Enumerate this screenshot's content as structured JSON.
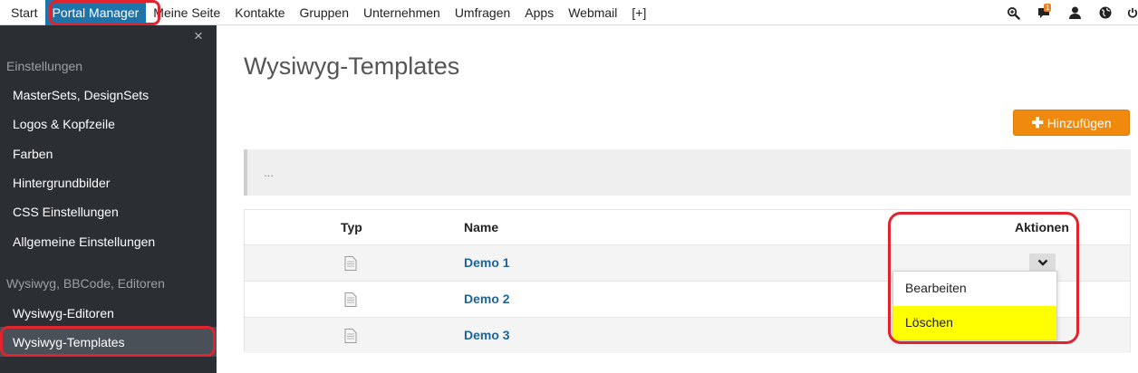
{
  "nav": {
    "items": [
      {
        "label": "Start"
      },
      {
        "label": "Portal Manager"
      },
      {
        "label": "Meine Seite"
      },
      {
        "label": "Kontakte"
      },
      {
        "label": "Gruppen"
      },
      {
        "label": "Unternehmen"
      },
      {
        "label": "Umfragen"
      },
      {
        "label": "Apps"
      },
      {
        "label": "Webmail"
      },
      {
        "label": "[+]"
      }
    ],
    "active_index": 1,
    "icons": [
      "search-icon",
      "chat-icon",
      "user-icon",
      "globe-icon",
      "power-icon"
    ],
    "chat_badge": "1"
  },
  "sidebar": {
    "close": "×",
    "section1": "Einstellungen",
    "items1": [
      "MasterSets, DesignSets",
      "Logos & Kopfzeile",
      "Farben",
      "Hintergrundbilder",
      "CSS Einstellungen",
      "Allgemeine Einstellungen"
    ],
    "section2": "Wysiwyg, BBCode, Editoren",
    "items2": [
      "Wysiwyg-Editoren",
      "Wysiwyg-Templates"
    ],
    "active_item": "Wysiwyg-Templates"
  },
  "main": {
    "title": "Wysiwyg-Templates",
    "add_button": "Hinzufügen",
    "info_text": "...",
    "table": {
      "headers": {
        "type": "Typ",
        "name": "Name",
        "actions": "Aktionen"
      },
      "rows": [
        {
          "name": "Demo 1"
        },
        {
          "name": "Demo 2"
        },
        {
          "name": "Demo 3"
        }
      ]
    },
    "dropdown": {
      "items": [
        "Bearbeiten",
        "Löschen"
      ],
      "highlighted": "Löschen"
    }
  },
  "colors": {
    "accent": "#1e73a8",
    "button": "#f08a0f",
    "highlight_ring": "#e0232e",
    "sidebar_bg": "#2b2f33",
    "link": "#1e6496"
  }
}
